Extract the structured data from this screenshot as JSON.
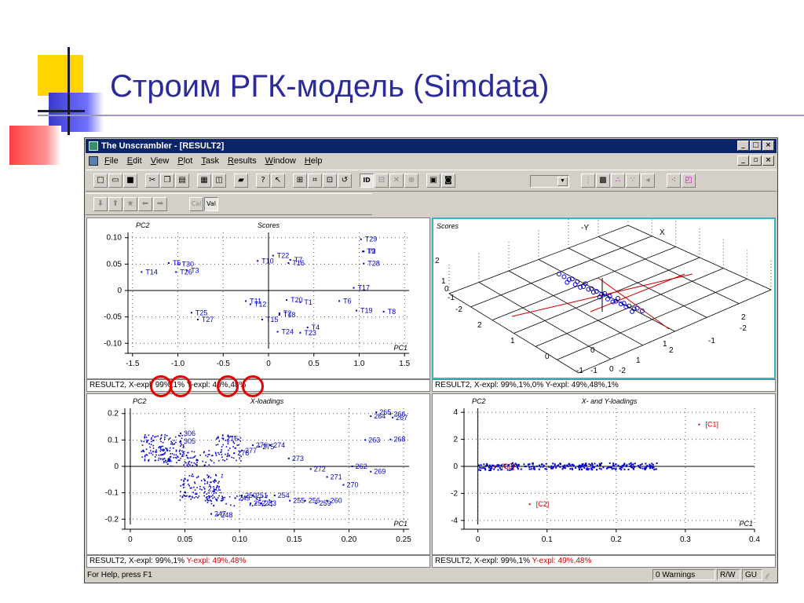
{
  "slide": {
    "title": "Строим РГК-модель (Simdata)"
  },
  "colors": {
    "title": "#2b2b9a",
    "titlebar": "#0a246a",
    "points": "#0000cc",
    "red": "#cc0000",
    "active_panel": "#36b6c0"
  },
  "window": {
    "title": "The Unscrambler - [RESULT2]",
    "caption_buttons": [
      "_",
      "□",
      "×"
    ],
    "mdi_buttons": [
      "_",
      "▫",
      "×"
    ]
  },
  "menu": {
    "items": [
      "File",
      "Edit",
      "View",
      "Plot",
      "Task",
      "Results",
      "Window",
      "Help"
    ]
  },
  "toolbar": {
    "icons": [
      "new-icon",
      "open-icon",
      "save-icon",
      "cut-icon",
      "copy-icon",
      "paste-icon",
      "print-icon",
      "print-preview-icon",
      "edit-icon",
      "help-icon",
      "context-help-icon",
      "zoom-window-icon",
      "zoom-fit-icon",
      "zoom-icon",
      "refresh-icon",
      "id-icon",
      "grid-icon",
      "cross-icon",
      "target-icon",
      "layout-icon",
      "marker-icon",
      "combo",
      "pc-axes-icon",
      "scatter-icon",
      "scatter-color-icon",
      "scatter-select-icon",
      "arrow-left-plot-icon",
      "dots-icon",
      "box-select-icon"
    ],
    "labels": {
      "id": "ID"
    }
  },
  "toolbar2": {
    "icons": [
      "down-arrow-icon",
      "up-arrow-icon",
      "star-icon",
      "left-arrow-icon",
      "right-arrow-icon",
      "cal-icon",
      "val-icon"
    ],
    "labels": {
      "cal": "Cal",
      "val": "Val"
    }
  },
  "scores_plot": {
    "title": "Scores",
    "xlabel": "PC1",
    "ylabel": "PC2",
    "x_ticks": [
      "-1.5",
      "-1.0",
      "-0.5",
      "0",
      "0.5",
      "1.0",
      "1.5"
    ],
    "y_ticks": [
      "0.10",
      "0.05",
      "0",
      "-0.05",
      "-0.10"
    ],
    "status": "RESULT2, X-expl: 99%,1%  Y-expl: 49%,48%"
  },
  "scores3d_plot": {
    "title": "Scores",
    "axis_x": "X",
    "axis_y": "-Y",
    "tick_labels": [
      "2",
      "1",
      "0",
      "-1",
      "-2",
      "2",
      "1",
      "0",
      "-1",
      "2",
      "1",
      "0",
      "-1",
      "-2",
      "2",
      "1",
      "0",
      "-1",
      "-2"
    ],
    "status": "RESULT2, X-expl: 99%,1%,0%  Y-expl: 49%,48%,1%"
  },
  "xloadings_plot": {
    "title": "X-loadings",
    "xlabel": "PC1",
    "ylabel": "PC2",
    "x_ticks": [
      "0",
      "0.05",
      "0.10",
      "0.15",
      "0.20",
      "0.25"
    ],
    "y_ticks": [
      "0.2",
      "0.1",
      "0",
      "-0.1",
      "-0.2"
    ],
    "status_black": "RESULT2, X-expl: 99%,1%  ",
    "status_red": "Y-expl: 49%,48%"
  },
  "xyloadings_plot": {
    "title": "X- and Y-loadings",
    "xlabel": "PC1",
    "ylabel": "PC2",
    "x_ticks": [
      "0",
      "0.1",
      "0.2",
      "0.3",
      "0.4"
    ],
    "y_ticks": [
      "4",
      "2",
      "0",
      "-2",
      "-4"
    ],
    "status_black": "RESULT2, X-expl: 99%,1%  ",
    "status_red": "Y-expl: 49%,48%"
  },
  "statusbar": {
    "help": "For Help, press F1",
    "warnings": "0 Warnings",
    "mode": "R/W",
    "gu": "GU"
  },
  "chart_data": [
    {
      "type": "scatter",
      "title": "Scores",
      "xlabel": "PC1",
      "ylabel": "PC2",
      "xlim": [
        -1.5,
        1.5
      ],
      "ylim": [
        -0.1,
        0.1
      ],
      "points": [
        {
          "label": "T29",
          "x": 1.02,
          "y": 0.097
        },
        {
          "label": "T3",
          "x": 1.05,
          "y": 0.074
        },
        {
          "label": "T9",
          "x": 1.04,
          "y": 0.074
        },
        {
          "label": "T28",
          "x": 1.05,
          "y": 0.051
        },
        {
          "label": "T17",
          "x": 0.94,
          "y": 0.005
        },
        {
          "label": "T6",
          "x": 0.78,
          "y": -0.02
        },
        {
          "label": "T19",
          "x": 0.97,
          "y": -0.038
        },
        {
          "label": "T8",
          "x": 1.27,
          "y": -0.04
        },
        {
          "label": "T22",
          "x": 0.05,
          "y": 0.066
        },
        {
          "label": "T10",
          "x": -0.12,
          "y": 0.056
        },
        {
          "label": "T7",
          "x": 0.24,
          "y": 0.058
        },
        {
          "label": "T16",
          "x": 0.22,
          "y": 0.052
        },
        {
          "label": "T5",
          "x": -1.1,
          "y": 0.052
        },
        {
          "label": "T30",
          "x": -1.0,
          "y": 0.05
        },
        {
          "label": "T14",
          "x": -1.4,
          "y": 0.035
        },
        {
          "label": "T26",
          "x": -1.02,
          "y": 0.035
        },
        {
          "label": "T3",
          "x": -0.9,
          "y": 0.038
        },
        {
          "label": "T11",
          "x": -0.25,
          "y": -0.02
        },
        {
          "label": "T12",
          "x": -0.2,
          "y": -0.026
        },
        {
          "label": "T20",
          "x": 0.2,
          "y": -0.018
        },
        {
          "label": "T1",
          "x": 0.35,
          "y": -0.022
        },
        {
          "label": "T25",
          "x": -0.85,
          "y": -0.042
        },
        {
          "label": "T27",
          "x": -0.78,
          "y": -0.055
        },
        {
          "label": "T15",
          "x": -0.07,
          "y": -0.055
        },
        {
          "label": "T18",
          "x": 0.12,
          "y": -0.046
        },
        {
          "label": "T2",
          "x": 0.12,
          "y": -0.043
        },
        {
          "label": "T4",
          "x": 0.43,
          "y": -0.07
        },
        {
          "label": "T24",
          "x": 0.1,
          "y": -0.078
        },
        {
          "label": "T23",
          "x": 0.35,
          "y": -0.08
        }
      ]
    },
    {
      "type": "scatter",
      "title": "X-loadings",
      "xlabel": "PC1",
      "ylabel": "PC2",
      "xlim": [
        0,
        0.25
      ],
      "ylim": [
        -0.2,
        0.2
      ],
      "labeled_points": [
        {
          "label": "265",
          "x": 0.225,
          "y": 0.205
        },
        {
          "label": "264",
          "x": 0.22,
          "y": 0.19
        },
        {
          "label": "266",
          "x": 0.238,
          "y": 0.198
        },
        {
          "label": "267",
          "x": 0.24,
          "y": 0.185
        },
        {
          "label": "263",
          "x": 0.215,
          "y": 0.1
        },
        {
          "label": "268",
          "x": 0.238,
          "y": 0.102
        },
        {
          "label": "262",
          "x": 0.203,
          "y": 0.0
        },
        {
          "label": "269",
          "x": 0.22,
          "y": -0.02
        },
        {
          "label": "272",
          "x": 0.165,
          "y": -0.01
        },
        {
          "label": "271",
          "x": 0.18,
          "y": -0.04
        },
        {
          "label": "270",
          "x": 0.195,
          "y": -0.07
        },
        {
          "label": "273",
          "x": 0.145,
          "y": 0.03
        },
        {
          "label": "274",
          "x": 0.128,
          "y": 0.08
        },
        {
          "label": "276",
          "x": 0.112,
          "y": 0.08
        },
        {
          "label": "275",
          "x": 0.118,
          "y": 0.075
        },
        {
          "label": "277",
          "x": 0.102,
          "y": 0.06
        },
        {
          "label": "278",
          "x": 0.095,
          "y": 0.05
        },
        {
          "label": "260",
          "x": 0.18,
          "y": -0.13
        },
        {
          "label": "259",
          "x": 0.17,
          "y": -0.14
        },
        {
          "label": "254",
          "x": 0.132,
          "y": -0.11
        },
        {
          "label": "255",
          "x": 0.146,
          "y": -0.13
        },
        {
          "label": "256",
          "x": 0.16,
          "y": -0.13
        },
        {
          "label": "253",
          "x": 0.12,
          "y": -0.14
        },
        {
          "label": "252",
          "x": 0.11,
          "y": -0.14
        },
        {
          "label": "251",
          "x": 0.112,
          "y": -0.11
        },
        {
          "label": "250",
          "x": 0.102,
          "y": -0.11
        },
        {
          "label": "249",
          "x": 0.096,
          "y": -0.12
        },
        {
          "label": "248",
          "x": 0.08,
          "y": -0.185
        },
        {
          "label": "247",
          "x": 0.074,
          "y": -0.18
        },
        {
          "label": "306",
          "x": 0.046,
          "y": 0.125
        },
        {
          "label": "305",
          "x": 0.046,
          "y": 0.095
        },
        {
          "label": "210",
          "x": 0.068,
          "y": -0.085
        },
        {
          "label": "216",
          "x": 0.085,
          "y": 0.105
        }
      ]
    },
    {
      "type": "scatter",
      "title": "X- and Y-loadings",
      "xlabel": "PC1",
      "ylabel": "PC2",
      "xlim": [
        0,
        0.4
      ],
      "ylim": [
        -4,
        4
      ],
      "y_variables": [
        {
          "label": "[C1]",
          "x": 0.32,
          "y": 3.1
        },
        {
          "label": "[C2]",
          "x": 0.075,
          "y": -2.8
        },
        {
          "label": "[C3]",
          "x": 0.025,
          "y": 0.0
        }
      ]
    }
  ]
}
